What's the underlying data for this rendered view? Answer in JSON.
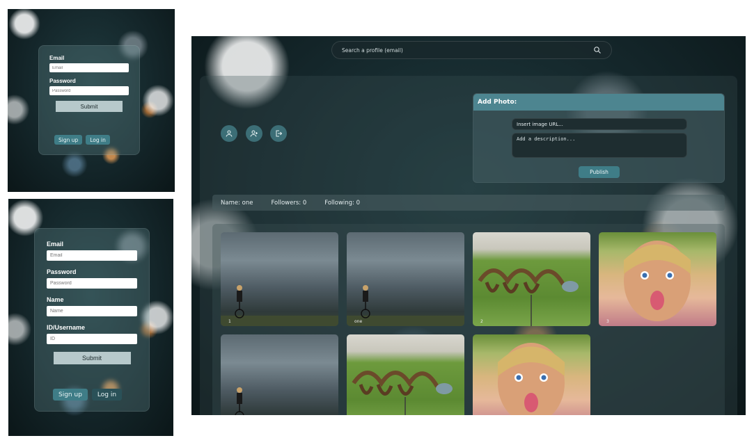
{
  "login": {
    "email_label": "Email",
    "email_placeholder": "Email",
    "password_label": "Password",
    "password_placeholder": "Password",
    "submit_label": "Submit",
    "signup_label": "Sign up",
    "login_label": "Log in"
  },
  "signup": {
    "email_label": "Email",
    "email_placeholder": "Email",
    "password_label": "Password",
    "password_placeholder": "Password",
    "name_label": "Name",
    "name_placeholder": "Name",
    "id_label": "ID/Username",
    "id_placeholder": "ID",
    "submit_label": "Submit",
    "signup_label": "Sign up",
    "login_label": "Log in"
  },
  "search": {
    "placeholder": "Search a profile (email)",
    "icon": "search-icon"
  },
  "profile_actions": [
    {
      "icon": "user-icon"
    },
    {
      "icon": "user-follow-icon"
    },
    {
      "icon": "logout-icon"
    }
  ],
  "add_photo": {
    "title": "Add Photo:",
    "url_placeholder": "Insert image URL...",
    "description_placeholder": "Add a description...",
    "publish_label": "Publish"
  },
  "stats": {
    "name": "Name: one",
    "followers": "Followers: 0",
    "following": "Following: 0"
  },
  "gallery": [
    {
      "caption": "1",
      "scene": "storm"
    },
    {
      "caption": "one",
      "scene": "storm"
    },
    {
      "caption": "2",
      "scene": "dino"
    },
    {
      "caption": "3",
      "scene": "girl"
    },
    {
      "caption": "",
      "scene": "storm"
    },
    {
      "caption": "",
      "scene": "dino"
    },
    {
      "caption": "",
      "scene": "girl"
    }
  ],
  "colors": {
    "accent": "#3f7d87",
    "header": "#4d8590",
    "background": "#14262a"
  }
}
